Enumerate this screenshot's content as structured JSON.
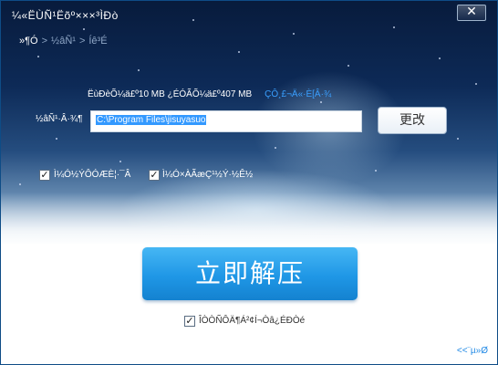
{
  "window": {
    "title": "¼«ËÙÑ¹Ëõº×××³ÌÐò",
    "close_label": "✕"
  },
  "steps": {
    "current": "»¶Ó­",
    "separator": ">",
    "step2": "½âÑ¹",
    "step3": "Íê³É"
  },
  "space_info": {
    "text": "ËùÐèÕ¼ä£º10 MB ¿ÉÓÃÕ¼ä£º407 MB",
    "link": "ÇÔ¸£¬Ä«·È[Â·¾"
  },
  "path": {
    "label": "½âÑ¹·Â·¾¶",
    "value": "C:\\Program Files\\jisuyasuo"
  },
  "change_button": {
    "label": "更改"
  },
  "options": {
    "desktop_shortcut": {
      "label": "Ì¼Ó½ÝÔÓÆÈ¦·¯Â",
      "checked": true
    },
    "associate": {
      "label": "Ì¼Ó×ÀÃæÇ¹½Ý·½Ê½",
      "checked": true
    }
  },
  "extract_button": {
    "label": "立即解压"
  },
  "launch_after": {
    "label": "ÎÒÒÑÔÄ¶Á²¢Í¬Òâ¿ÉÐ­Òé",
    "checked": true
  },
  "advanced_link": {
    "label": "<<¨µ»Ø"
  },
  "colors": {
    "accent": "#1f97e6",
    "link": "#1e88e5",
    "window_border": "#0e4c86"
  }
}
